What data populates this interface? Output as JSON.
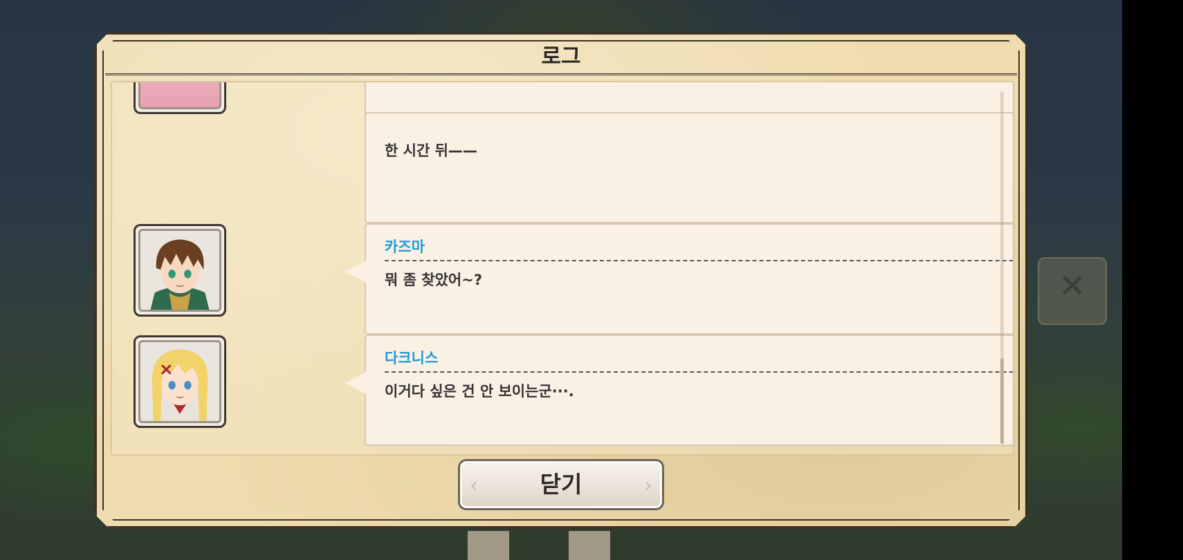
{
  "dialog": {
    "title": "로그",
    "close_label": "닫기"
  },
  "log": [
    {
      "speaker": "",
      "text": ""
    },
    {
      "speaker": "",
      "text": "한 시간 뒤——"
    },
    {
      "speaker": "카즈마",
      "text": "뭐 좀 찾았어~?"
    },
    {
      "speaker": "다크니스",
      "text": "이거다 싶은 건 안 보이는군···."
    }
  ],
  "background": {
    "skip_icon": "close-x-icon"
  },
  "colors": {
    "speaker_name": "#1e9ad6",
    "panel_bg": "#efdcae",
    "entry_bg": "#fbf0e4"
  }
}
